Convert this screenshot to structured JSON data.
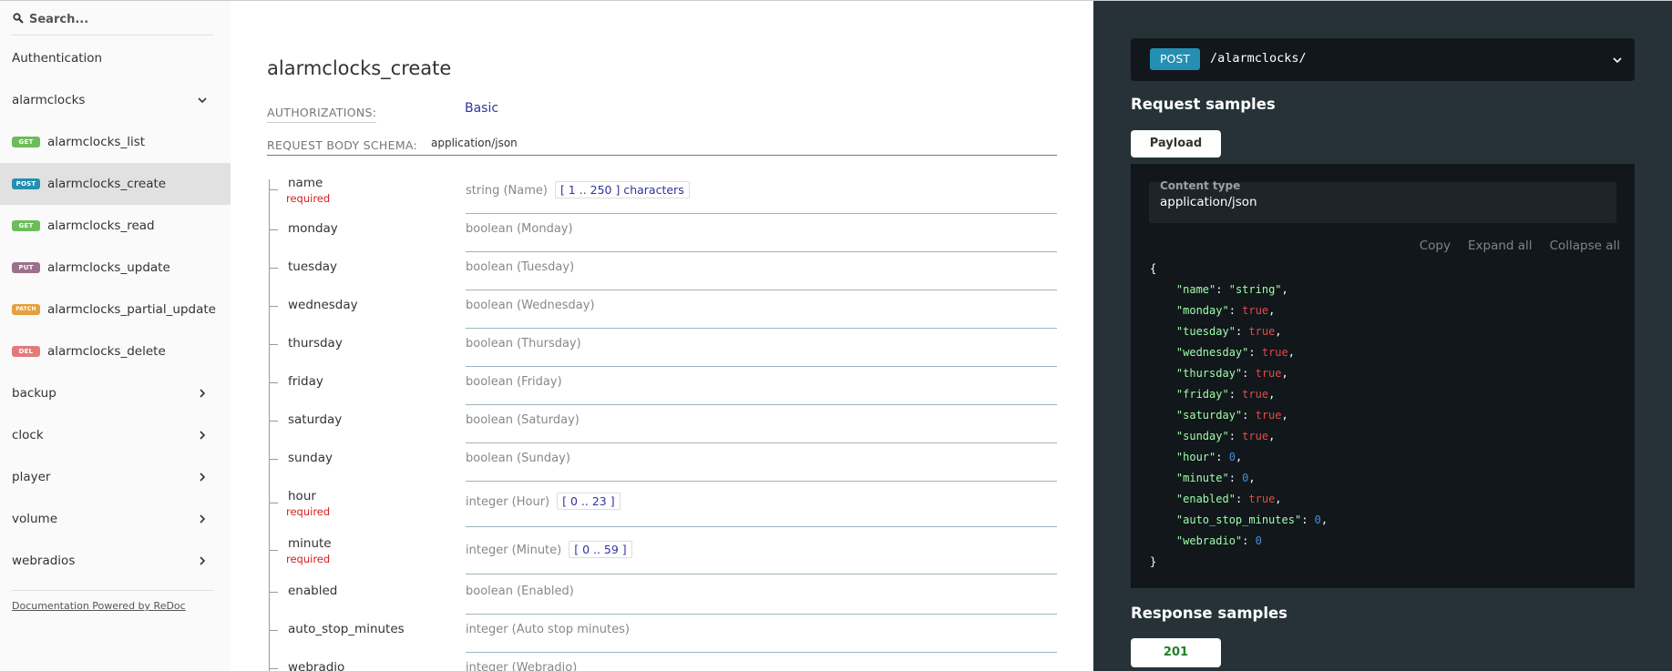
{
  "sidebar": {
    "search_placeholder": "Search...",
    "items": [
      {
        "label": "Authentication",
        "badge": "",
        "expandable": false
      },
      {
        "label": "alarmclocks",
        "badge": "",
        "expandable": true,
        "expanded": true
      },
      {
        "label": "alarmclocks_list",
        "badge": "GET"
      },
      {
        "label": "alarmclocks_create",
        "badge": "POST",
        "active": true
      },
      {
        "label": "alarmclocks_read",
        "badge": "GET"
      },
      {
        "label": "alarmclocks_update",
        "badge": "PUT"
      },
      {
        "label": "alarmclocks_partial_update",
        "badge": "PATCH"
      },
      {
        "label": "alarmclocks_delete",
        "badge": "DEL"
      },
      {
        "label": "backup",
        "badge": "",
        "expandable": true
      },
      {
        "label": "clock",
        "badge": "",
        "expandable": true
      },
      {
        "label": "player",
        "badge": "",
        "expandable": true
      },
      {
        "label": "volume",
        "badge": "",
        "expandable": true
      },
      {
        "label": "webradios",
        "badge": "",
        "expandable": true
      }
    ],
    "powered_by": "Documentation Powered by ReDoc"
  },
  "main": {
    "title": "alarmclocks_create",
    "auth_label": "AUTHORIZATIONS:",
    "auth_value": "Basic",
    "schema_label": "REQUEST BODY SCHEMA:",
    "schema_value": "application/json",
    "fields": [
      {
        "name": "name",
        "required": "required",
        "type": "string (Name)",
        "range": "[ 1 .. 250 ] characters"
      },
      {
        "name": "monday",
        "required": "",
        "type": "boolean (Monday)",
        "range": ""
      },
      {
        "name": "tuesday",
        "required": "",
        "type": "boolean (Tuesday)",
        "range": ""
      },
      {
        "name": "wednesday",
        "required": "",
        "type": "boolean (Wednesday)",
        "range": ""
      },
      {
        "name": "thursday",
        "required": "",
        "type": "boolean (Thursday)",
        "range": ""
      },
      {
        "name": "friday",
        "required": "",
        "type": "boolean (Friday)",
        "range": ""
      },
      {
        "name": "saturday",
        "required": "",
        "type": "boolean (Saturday)",
        "range": ""
      },
      {
        "name": "sunday",
        "required": "",
        "type": "boolean (Sunday)",
        "range": ""
      },
      {
        "name": "hour",
        "required": "required",
        "type": "integer (Hour)",
        "range": "[ 0 .. 23 ]"
      },
      {
        "name": "minute",
        "required": "required",
        "type": "integer (Minute)",
        "range": "[ 0 .. 59 ]"
      },
      {
        "name": "enabled",
        "required": "",
        "type": "boolean (Enabled)",
        "range": ""
      },
      {
        "name": "auto_stop_minutes",
        "required": "",
        "type": "integer (Auto stop minutes)",
        "range": ""
      },
      {
        "name": "webradio",
        "required": "",
        "type": "integer (Webradio)",
        "range": ""
      }
    ]
  },
  "right": {
    "method": "POST",
    "path": "/alarmclocks/",
    "request_samples_title": "Request samples",
    "payload_tab": "Payload",
    "content_type_label": "Content type",
    "content_type_value": "application/json",
    "actions": {
      "copy": "Copy",
      "expand_all": "Expand all",
      "collapse_all": "Collapse all"
    },
    "payload": [
      {
        "key": "name",
        "value": "\"string\"",
        "kind": "s"
      },
      {
        "key": "monday",
        "value": "true",
        "kind": "t"
      },
      {
        "key": "tuesday",
        "value": "true",
        "kind": "t"
      },
      {
        "key": "wednesday",
        "value": "true",
        "kind": "t"
      },
      {
        "key": "thursday",
        "value": "true",
        "kind": "t"
      },
      {
        "key": "friday",
        "value": "true",
        "kind": "t"
      },
      {
        "key": "saturday",
        "value": "true",
        "kind": "t"
      },
      {
        "key": "sunday",
        "value": "true",
        "kind": "t"
      },
      {
        "key": "hour",
        "value": "0",
        "kind": "n"
      },
      {
        "key": "minute",
        "value": "0",
        "kind": "n"
      },
      {
        "key": "enabled",
        "value": "true",
        "kind": "t"
      },
      {
        "key": "auto_stop_minutes",
        "value": "0",
        "kind": "n"
      },
      {
        "key": "webradio",
        "value": "0",
        "kind": "n"
      }
    ],
    "response_samples_title": "Response samples",
    "response_tab": "201"
  }
}
